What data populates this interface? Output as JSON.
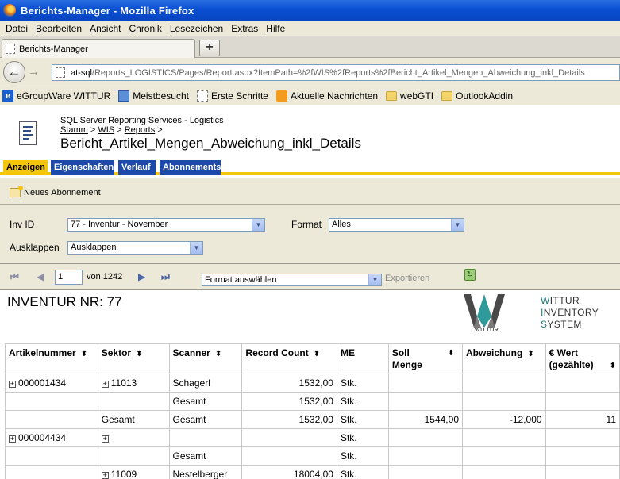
{
  "window": {
    "title": "Berichts-Manager - Mozilla Firefox"
  },
  "menu": [
    {
      "pre": "",
      "u": "D",
      "post": "atei"
    },
    {
      "pre": "",
      "u": "B",
      "post": "earbeiten"
    },
    {
      "pre": "",
      "u": "A",
      "post": "nsicht"
    },
    {
      "pre": "",
      "u": "C",
      "post": "hronik"
    },
    {
      "pre": "",
      "u": "L",
      "post": "esezeichen"
    },
    {
      "pre": "E",
      "u": "x",
      "post": "tras"
    },
    {
      "pre": "",
      "u": "H",
      "post": "ilfe"
    }
  ],
  "tab": {
    "title": "Berichts-Manager",
    "new_tab": "+"
  },
  "nav": {
    "back": "←",
    "forward": "→",
    "url_host": "at-sql",
    "url_path": "/Reports_LOGISTICS/Pages/Report.aspx?ItemPath=%2fWIS%2fReports%2fBericht_Artikel_Mengen_Abweichung_inkl_Details"
  },
  "bookmarks": [
    {
      "label": "eGroupWare WITTUR",
      "icon": "egroupware-icon"
    },
    {
      "label": "Meistbesucht",
      "icon": "most-visited-icon"
    },
    {
      "label": "Erste Schritte",
      "icon": "page-icon"
    },
    {
      "label": "Aktuelle Nachrichten",
      "icon": "rss-icon"
    },
    {
      "label": "webGTI",
      "icon": "folder-icon"
    },
    {
      "label": "OutlookAddin",
      "icon": "folder-icon"
    }
  ],
  "report_header": {
    "service": "SQL Server Reporting Services - Logistics",
    "crumbs": [
      "Stamm",
      "WIS",
      "Reports"
    ],
    "crumb_sep": " > ",
    "name": "Bericht_Artikel_Mengen_Abweichung_inkl_Details"
  },
  "rs_tabs": [
    "Anzeigen",
    "Eigenschaften",
    "Verlauf",
    "Abonnements"
  ],
  "toolbar": {
    "new_subscription": "Neues Abonnement"
  },
  "params": {
    "inv_id_label": "Inv ID",
    "inv_id_value": "77 - Inventur - November",
    "format_label": "Format",
    "format_value": "Alles",
    "ausklappen_label": "Ausklappen",
    "ausklappen_value": "Ausklappen"
  },
  "viewer": {
    "page": "1",
    "of_label": "von 1242",
    "export_format": "Format auswählen",
    "export_label": "Exportieren"
  },
  "report": {
    "heading": "INVENTUR NR: 77",
    "logo_caption": "WITTUR",
    "system_lines": [
      {
        "first": "W",
        "rest": "ITTUR"
      },
      {
        "first": "I",
        "rest": "NVENTORY"
      },
      {
        "first": "S",
        "rest": "YSTEM"
      }
    ],
    "columns": [
      {
        "label": "Artikelnummer",
        "sortable": true
      },
      {
        "label": "Sektor",
        "sortable": true
      },
      {
        "label": "Scanner",
        "sortable": true
      },
      {
        "label": "Record Count",
        "sortable": true
      },
      {
        "label": "ME",
        "sortable": false
      },
      {
        "label": "Soll Menge",
        "sortable": true
      },
      {
        "label": "Abweichung",
        "sortable": true
      },
      {
        "label": "€ Wert (gezählte)",
        "sortable": true
      }
    ],
    "rows": [
      {
        "art": "000001434",
        "art_plus": true,
        "sek": "11013",
        "sek_plus": true,
        "scanner": "Schagerl",
        "count": "1532,00",
        "me": "Stk.",
        "soll": "",
        "abw": "",
        "wert": ""
      },
      {
        "art": "",
        "art_plus": false,
        "sek": "",
        "sek_plus": false,
        "scanner": "Gesamt",
        "count": "1532,00",
        "me": "Stk.",
        "soll": "",
        "abw": "",
        "wert": ""
      },
      {
        "art": "",
        "art_plus": false,
        "sek": "Gesamt",
        "sek_plus": false,
        "scanner": "Gesamt",
        "count": "1532,00",
        "me": "Stk.",
        "soll": "1544,00",
        "abw": "-12,000",
        "wert": "11"
      },
      {
        "art": "000004434",
        "art_plus": true,
        "sek": "",
        "sek_plus": true,
        "scanner": "",
        "count": "",
        "me": "Stk.",
        "soll": "",
        "abw": "",
        "wert": ""
      },
      {
        "art": "",
        "art_plus": false,
        "sek": "",
        "sek_plus": false,
        "scanner": "Gesamt",
        "count": "",
        "me": "Stk.",
        "soll": "",
        "abw": "",
        "wert": ""
      },
      {
        "art": "",
        "art_plus": false,
        "sek": "11009",
        "sek_plus": true,
        "scanner": "Nestelberger",
        "count": "18004,00",
        "me": "Stk.",
        "soll": "",
        "abw": "",
        "wert": ""
      }
    ],
    "sort_glyph": "⬍"
  }
}
